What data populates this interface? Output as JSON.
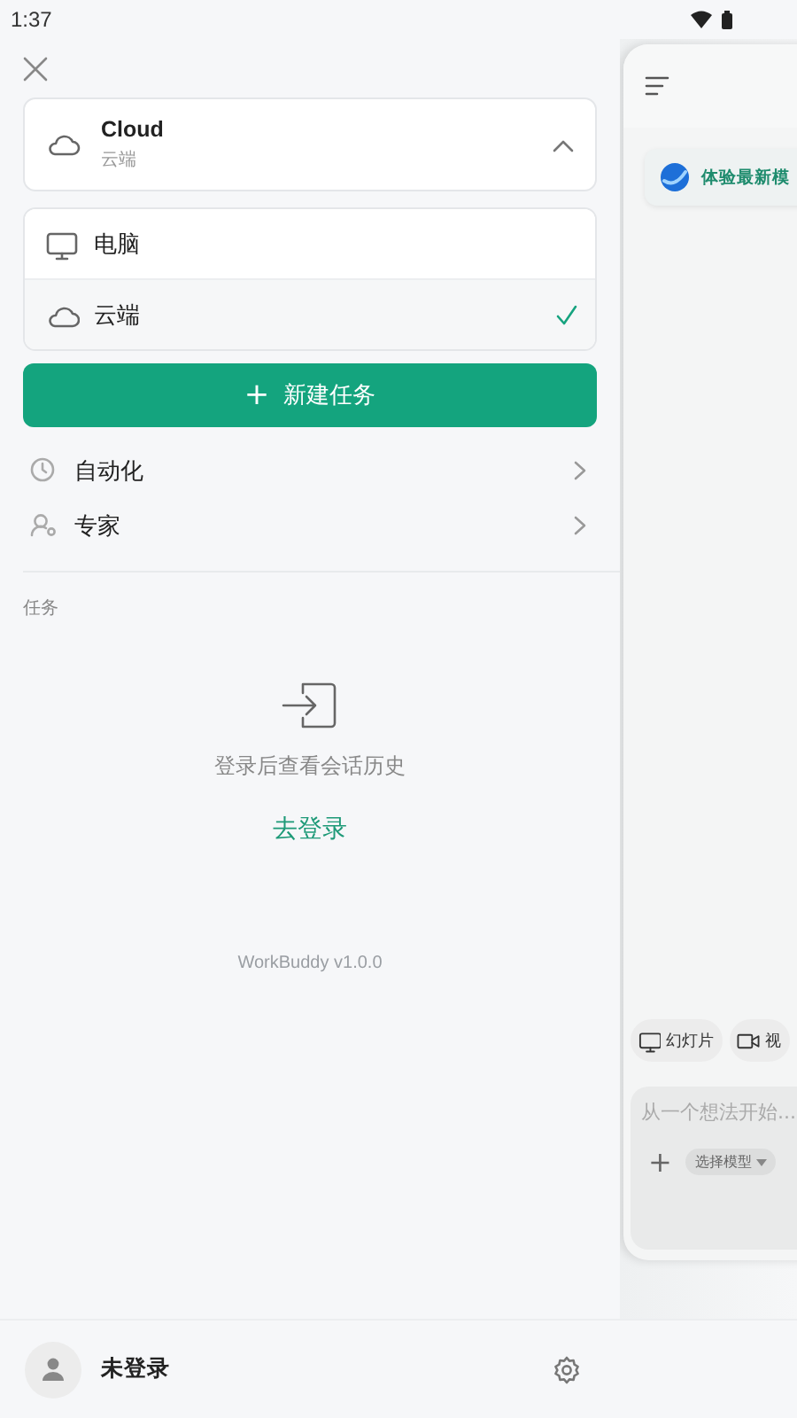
{
  "status_bar": {
    "time": "1:37"
  },
  "drawer": {
    "mode_selector": {
      "title": "Cloud",
      "subtitle": "云端",
      "expanded": true
    },
    "mode_options": [
      {
        "label": "电脑",
        "kind": "computer",
        "selected": false
      },
      {
        "label": "云端",
        "kind": "cloud",
        "selected": true
      }
    ],
    "new_task_button": {
      "icon": "+",
      "label": "新建任务"
    },
    "nav_items": [
      {
        "label": "自动化",
        "kind": "automation"
      },
      {
        "label": "专家",
        "kind": "experts"
      }
    ],
    "section_label": "任务",
    "empty_state": {
      "message": "登录后查看会话历史",
      "link": "去登录"
    },
    "version": "WorkBuddy v1.0.0"
  },
  "preview": {
    "banner": "体验最新模",
    "chips": [
      {
        "label": "幻灯片",
        "kind": "slides"
      },
      {
        "label": "视",
        "kind": "video"
      }
    ],
    "input": {
      "placeholder": "从一个想法开始..."
    },
    "add": "+",
    "model_picker": "选择模型"
  },
  "footer": {
    "user_name": "未登录"
  }
}
